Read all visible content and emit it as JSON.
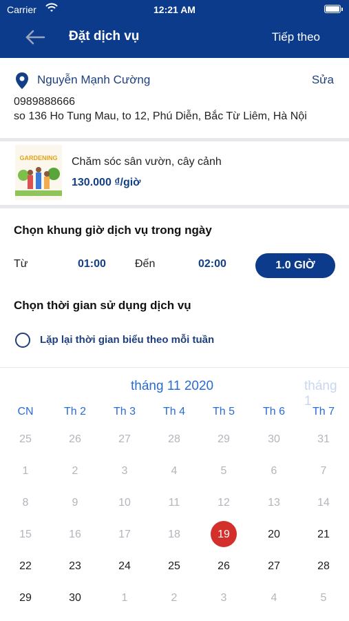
{
  "status_bar": {
    "carrier": "Carrier",
    "time": "12:21 AM"
  },
  "header": {
    "title": "Đặt dịch vụ",
    "next_label": "Tiếp theo"
  },
  "address": {
    "name": "Nguyễn Mạnh Cường",
    "edit_label": "Sửa",
    "phone": "0989888666",
    "line": "so 136 Ho Tung Mau, to 12, Phú Diễn, Bắc Từ Liêm, Hà Nội"
  },
  "service": {
    "image_text": "GARDENING",
    "name": "Chăm sóc sân vườn, cây cảnh",
    "price": "130.000 ₫/giờ"
  },
  "time_slot": {
    "heading": "Chọn khung giờ dịch vụ trong ngày",
    "from_label": "Từ",
    "from_value": "01:00",
    "to_label": "Đến",
    "to_value": "02:00",
    "duration": "1.0 GIỜ"
  },
  "usage": {
    "heading": "Chọn thời gian sử dụng dịch vụ",
    "repeat_label": "Lặp lại thời gian biểu theo mỗi tuần"
  },
  "calendar": {
    "month": "tháng 11 2020",
    "next_month": "tháng 1",
    "weekdays": [
      "CN",
      "Th 2",
      "Th 3",
      "Th 4",
      "Th 5",
      "Th 6",
      "Th 7"
    ],
    "weeks": [
      [
        "25",
        "26",
        "27",
        "28",
        "29",
        "30",
        "31"
      ],
      [
        "1",
        "2",
        "3",
        "4",
        "5",
        "6",
        "7"
      ],
      [
        "8",
        "9",
        "10",
        "11",
        "12",
        "13",
        "14"
      ],
      [
        "15",
        "16",
        "17",
        "18",
        "19",
        "20",
        "21"
      ],
      [
        "22",
        "23",
        "24",
        "25",
        "26",
        "27",
        "28"
      ],
      [
        "29",
        "30",
        "1",
        "2",
        "3",
        "4",
        "5"
      ]
    ],
    "selected_day": "19"
  },
  "colors": {
    "primary": "#0d3b8c",
    "accent_blue": "#2a6bd1",
    "today_red": "#d3302b"
  }
}
